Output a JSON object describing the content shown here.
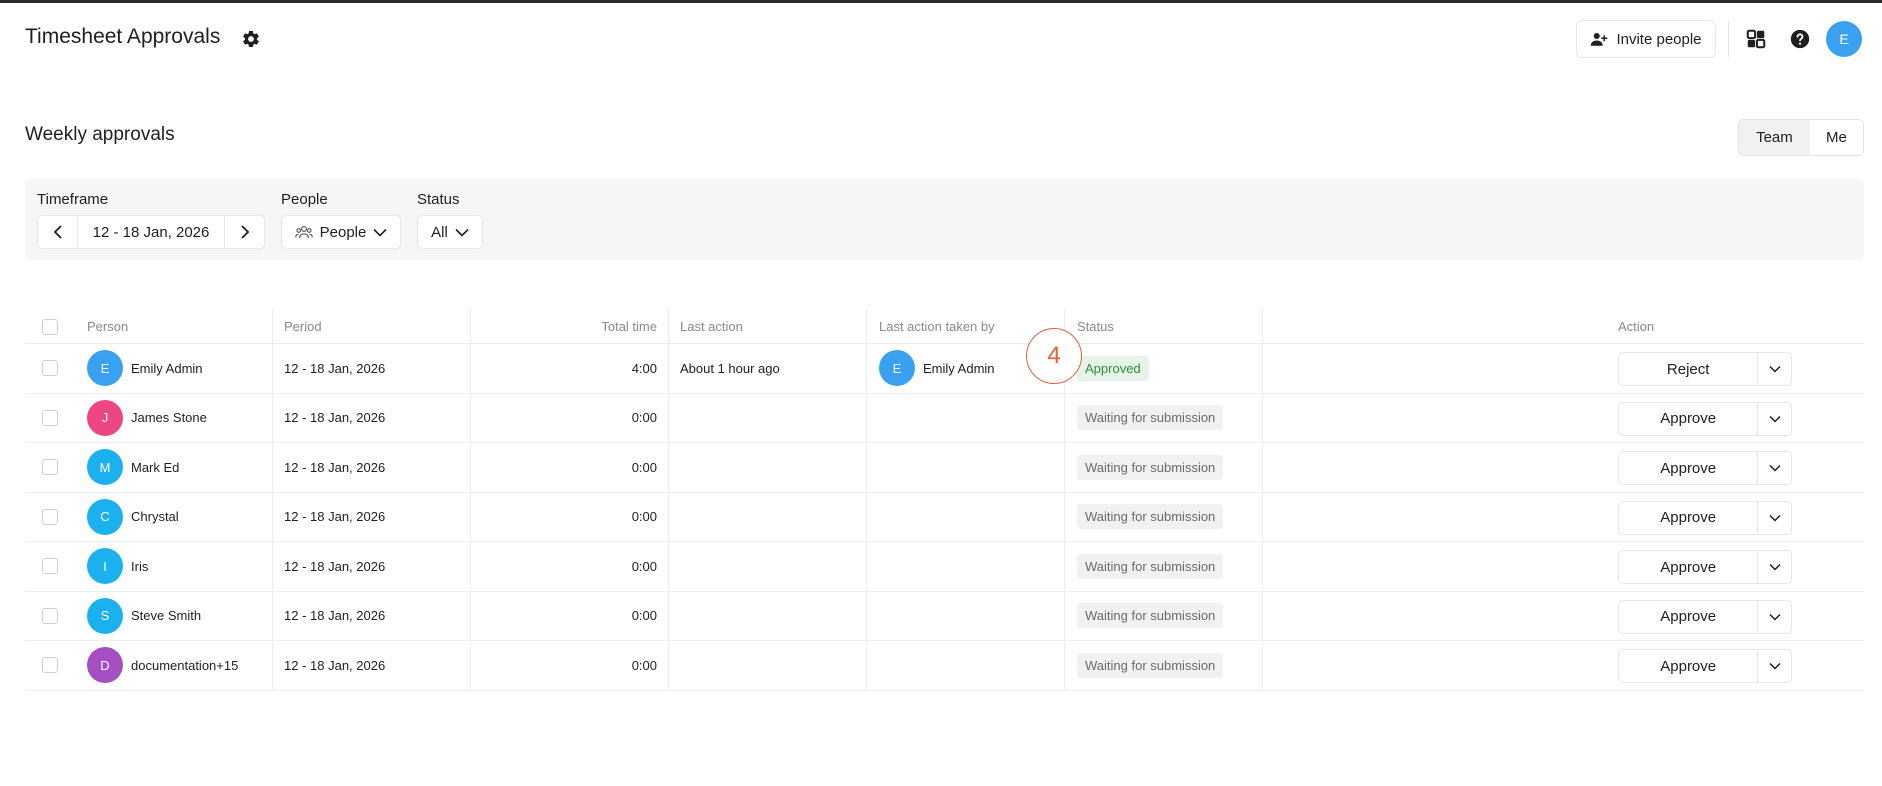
{
  "header": {
    "title": "Timesheet Approvals",
    "invite_label": "Invite people",
    "user_initial": "E",
    "icons": [
      "gear-icon",
      "user-plus-icon",
      "apps-icon",
      "help-icon"
    ]
  },
  "section": {
    "title": "Weekly approvals",
    "toggle": {
      "team": "Team",
      "me": "Me",
      "selected": "Team"
    }
  },
  "filters": {
    "timeframe_label": "Timeframe",
    "timeframe_value": "12 - 18 Jan, 2026",
    "people_label": "People",
    "people_value": "People",
    "status_label": "Status",
    "status_value": "All"
  },
  "table": {
    "columns": {
      "person": "Person",
      "period": "Period",
      "total_time": "Total time",
      "last_action": "Last action",
      "last_action_by": "Last action taken by",
      "status": "Status",
      "action": "Action"
    },
    "rows": [
      {
        "initial": "E",
        "name": "Emily Admin",
        "color": "#3aa0f0",
        "period": "12 - 18 Jan, 2026",
        "total": "4:00",
        "last_action": "About 1 hour ago",
        "by_initial": "E",
        "by_name": "Emily Admin",
        "status": "Approved",
        "status_type": "approved",
        "action": "Reject"
      },
      {
        "initial": "J",
        "name": "James Stone",
        "color": "#ee4680",
        "period": "12 - 18 Jan, 2026",
        "total": "0:00",
        "last_action": "",
        "by_initial": "",
        "by_name": "",
        "status": "Waiting for submission",
        "status_type": "waiting",
        "action": "Approve"
      },
      {
        "initial": "M",
        "name": "Mark Ed",
        "color": "#1bb1ee",
        "period": "12 - 18 Jan, 2026",
        "total": "0:00",
        "last_action": "",
        "by_initial": "",
        "by_name": "",
        "status": "Waiting for submission",
        "status_type": "waiting",
        "action": "Approve"
      },
      {
        "initial": "C",
        "name": "Chrystal",
        "color": "#1bb1ee",
        "period": "12 - 18 Jan, 2026",
        "total": "0:00",
        "last_action": "",
        "by_initial": "",
        "by_name": "",
        "status": "Waiting for submission",
        "status_type": "waiting",
        "action": "Approve"
      },
      {
        "initial": "I",
        "name": "Iris",
        "color": "#1bb1ee",
        "period": "12 - 18 Jan, 2026",
        "total": "0:00",
        "last_action": "",
        "by_initial": "",
        "by_name": "",
        "status": "Waiting for submission",
        "status_type": "waiting",
        "action": "Approve"
      },
      {
        "initial": "S",
        "name": "Steve Smith",
        "color": "#1bb1ee",
        "period": "12 - 18 Jan, 2026",
        "total": "0:00",
        "last_action": "",
        "by_initial": "",
        "by_name": "",
        "status": "Waiting for submission",
        "status_type": "waiting",
        "action": "Approve"
      },
      {
        "initial": "D",
        "name": "documentation+15",
        "color": "#a64fc2",
        "period": "12 - 18 Jan, 2026",
        "total": "0:00",
        "last_action": "",
        "by_initial": "",
        "by_name": "",
        "status": "Waiting for submission",
        "status_type": "waiting",
        "action": "Approve"
      }
    ]
  },
  "annotation": {
    "step_number": "4",
    "color": "#e0603a"
  }
}
